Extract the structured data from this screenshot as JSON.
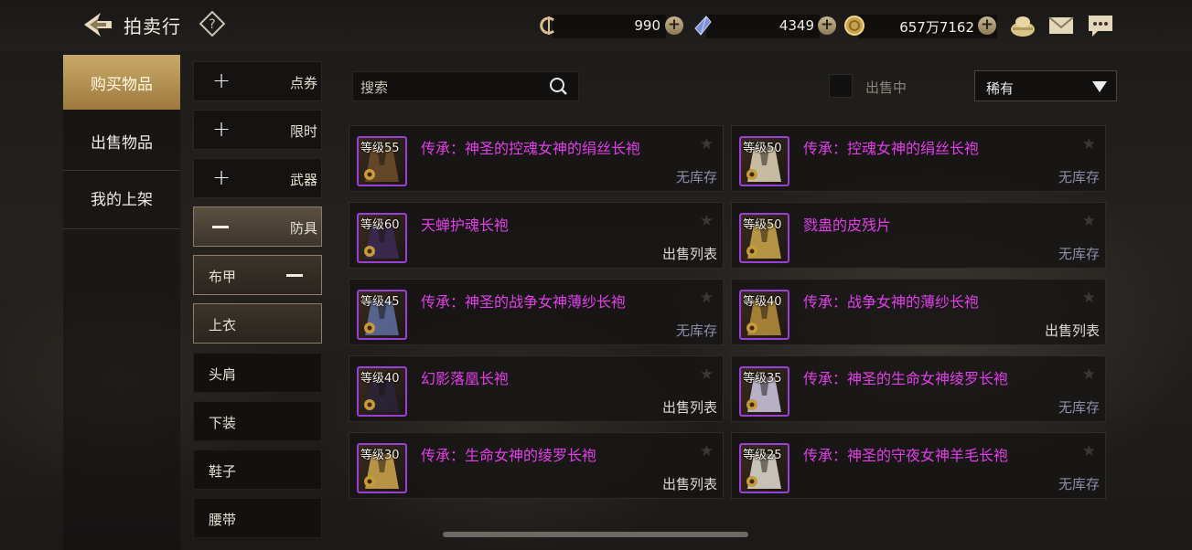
{
  "header": {
    "title": "拍卖行",
    "back_icon": "back-arrow-icon",
    "help_icon": "question-diamond-icon",
    "currencies": [
      {
        "icon": "c-coin-icon",
        "value": "990"
      },
      {
        "icon": "crystal-icon",
        "value": "4349"
      },
      {
        "icon": "gold-coin-icon",
        "value": "657万7162"
      }
    ],
    "icons": [
      "coin-bag-icon",
      "mail-icon",
      "chat-icon"
    ]
  },
  "nav": {
    "items": [
      {
        "label": "购买物品",
        "active": true
      },
      {
        "label": "出售物品",
        "active": false
      },
      {
        "label": "我的上架",
        "active": false
      }
    ]
  },
  "categories": {
    "top": [
      {
        "label": "点券"
      },
      {
        "label": "限时"
      },
      {
        "label": "武器"
      }
    ],
    "expanded": {
      "label": "防具"
    },
    "subs": [
      {
        "label": "布甲"
      },
      {
        "label": "上衣"
      },
      {
        "label": "头肩"
      },
      {
        "label": "下装"
      },
      {
        "label": "鞋子"
      },
      {
        "label": "腰带"
      }
    ]
  },
  "filters": {
    "search_placeholder": "搜索",
    "on_sale_label": "出售中",
    "on_sale_checked": false,
    "rarity_selected": "稀有"
  },
  "items": [
    {
      "level": "等级55",
      "name": "传承：神圣的控魂女神的绢丝长袍",
      "status": "无库存",
      "in_stock": false
    },
    {
      "level": "等级50",
      "name": "传承：控魂女神的绢丝长袍",
      "status": "无库存",
      "in_stock": false
    },
    {
      "level": "等级60",
      "name": "天蝉护魂长袍",
      "status": "出售列表",
      "in_stock": true
    },
    {
      "level": "等级50",
      "name": "戮蛊的皮残片",
      "status": "无库存",
      "in_stock": false
    },
    {
      "level": "等级45",
      "name": "传承：神圣的战争女神薄纱长袍",
      "status": "无库存",
      "in_stock": false
    },
    {
      "level": "等级40",
      "name": "传承：战争女神的薄纱长袍",
      "status": "出售列表",
      "in_stock": true
    },
    {
      "level": "等级40",
      "name": "幻影落凰长袍",
      "status": "出售列表",
      "in_stock": true
    },
    {
      "level": "等级35",
      "name": "传承：神圣的生命女神绫罗长袍",
      "status": "无库存",
      "in_stock": false
    },
    {
      "level": "等级30",
      "name": "传承：生命女神的绫罗长袍",
      "status": "出售列表",
      "in_stock": true
    },
    {
      "level": "等级25",
      "name": "传承：神圣的守夜女神羊毛长袍",
      "status": "无库存",
      "in_stock": false
    }
  ],
  "colors": {
    "accent_gold": "#c9a968",
    "item_name": "#e03fe8",
    "rarity_border": "#9a3fd8",
    "out_of_stock": "#8b8fa8"
  }
}
